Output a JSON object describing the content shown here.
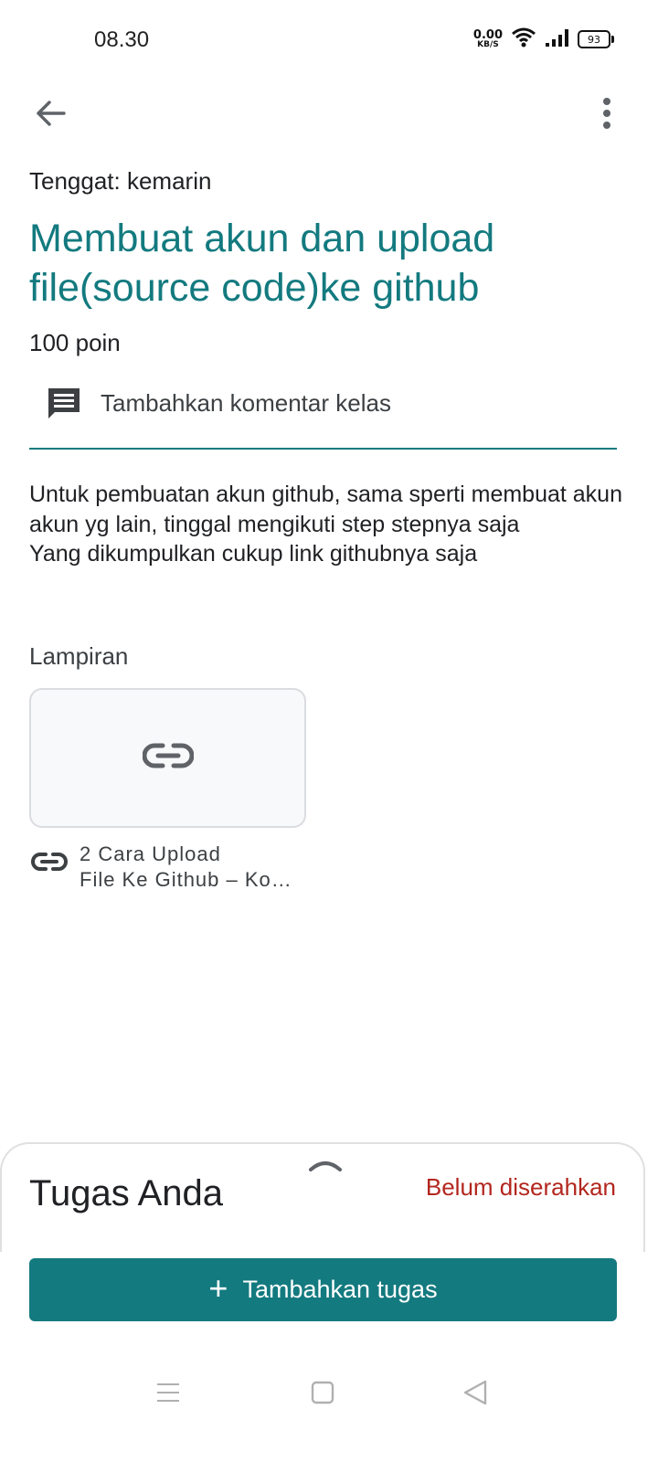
{
  "status_bar": {
    "time": "08.30",
    "net_speed_value": "0.00",
    "net_speed_unit": "KB/S",
    "battery": "93",
    "icons": [
      "wifi-icon",
      "signal-icon",
      "battery-icon"
    ]
  },
  "app_bar": {
    "back_icon": "arrow-back-icon",
    "more_icon": "more-vert-icon"
  },
  "assignment": {
    "due": "Tenggat: kemarin",
    "title": "Membuat akun dan upload file(source code)ke github",
    "points": "100 poin",
    "comment_label": "Tambahkan komentar kelas",
    "description": "Untuk pembuatan akun github, sama sperti membuat akun akun yg lain, tinggal mengikuti step stepnya saja\nYang dikumpulkan cukup link githubnya saja"
  },
  "attachments": {
    "heading": "Lampiran",
    "items": [
      {
        "title": "2 Cara Upload\nFile Ke Github – Ko…",
        "icon": "link-icon"
      }
    ]
  },
  "your_work": {
    "title": "Tugas Anda",
    "status": "Belum diserahkan",
    "add_button": "Tambahkan tugas"
  },
  "colors": {
    "accent": "#137a7f",
    "status_red": "#b3261e",
    "text": "#202124"
  }
}
